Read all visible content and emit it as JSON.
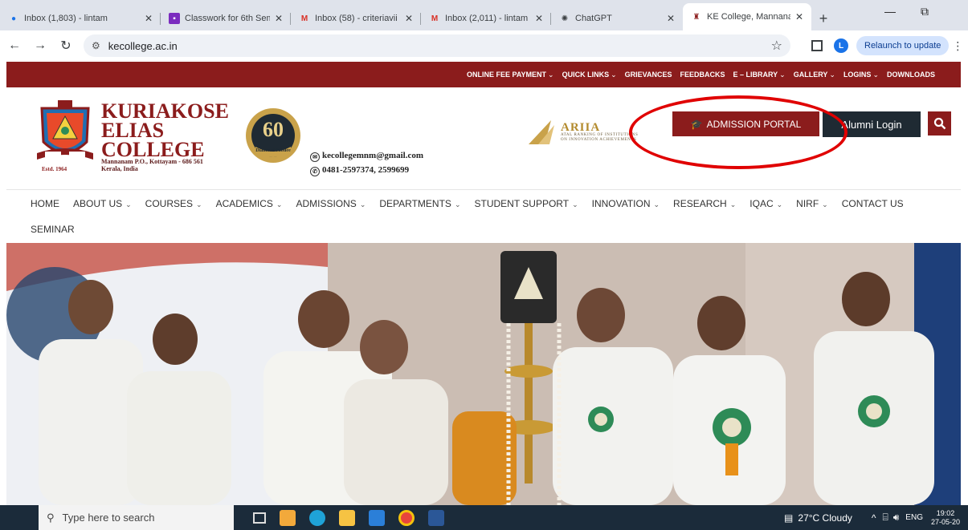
{
  "browser": {
    "tabs": [
      {
        "title": "Inbox (1,803) - lintam",
        "icon": "gmail-icon"
      },
      {
        "title": "Classwork for 6th Sem",
        "icon": "classroom-icon"
      },
      {
        "title": "Inbox (58) - criteriavii",
        "icon": "gmail-icon"
      },
      {
        "title": "Inbox (2,011) - lintam",
        "icon": "gmail-icon"
      },
      {
        "title": "ChatGPT",
        "icon": "chatgpt-icon"
      },
      {
        "title": "KE College, Mannanam",
        "icon": "college-favicon",
        "active": true
      }
    ],
    "url": "kecollege.ac.in",
    "profile_initial": "L",
    "relaunch_label": "Relaunch to update"
  },
  "site": {
    "top_links": [
      {
        "label": "ONLINE FEE PAYMENT",
        "dropdown": true
      },
      {
        "label": "QUICK LINKS",
        "dropdown": true
      },
      {
        "label": "GRIEVANCES",
        "dropdown": false
      },
      {
        "label": "FEEDBACKS",
        "dropdown": false
      },
      {
        "label": "E – LIBRARY",
        "dropdown": true
      },
      {
        "label": "GALLERY",
        "dropdown": true
      },
      {
        "label": "LOGINS",
        "dropdown": true
      },
      {
        "label": "DOWNLOADS",
        "dropdown": false
      }
    ],
    "college_name_lines": [
      "KURIAKOSE",
      "ELIAS",
      "COLLEGE"
    ],
    "address_lines": [
      "Mannanam P.O., Kottayam - 686 561",
      "Kerala, India"
    ],
    "estd": "Estd. 1964",
    "jubilee": {
      "number": "60",
      "text": "Diamond Jubilee"
    },
    "email": "kecollegemnm@gmail.com",
    "phone": "0481-2597374, 2599699",
    "ariia": {
      "name": "ARIIA",
      "sub_lines": [
        "ATAL RANKING OF INSTITUTIONS",
        "ON INNOVATION ACHIEVEMENTS"
      ]
    },
    "admission_portal_label": "ADMISSION PORTAL",
    "alumni_login_label": "Alumni Login",
    "main_nav": [
      {
        "label": "HOME",
        "dropdown": false
      },
      {
        "label": "ABOUT US",
        "dropdown": true
      },
      {
        "label": "COURSES",
        "dropdown": true
      },
      {
        "label": "ACADEMICS",
        "dropdown": true
      },
      {
        "label": "ADMISSIONS",
        "dropdown": true
      },
      {
        "label": "DEPARTMENTS",
        "dropdown": true
      },
      {
        "label": "STUDENT SUPPORT",
        "dropdown": true
      },
      {
        "label": "INNOVATION",
        "dropdown": true
      },
      {
        "label": "RESEARCH",
        "dropdown": true
      },
      {
        "label": "IQAC",
        "dropdown": true
      },
      {
        "label": "NIRF",
        "dropdown": true
      },
      {
        "label": "CONTACT US",
        "dropdown": false
      }
    ],
    "main_nav_row2": [
      {
        "label": "SEMINAR"
      }
    ],
    "colors": {
      "brand_red": "#8b1c1c",
      "dark_button": "#1f2a33",
      "annotation_red": "#e00000"
    }
  },
  "taskbar": {
    "search_placeholder": "Type here to search",
    "weather": "27°C  Cloudy",
    "language": "ENG",
    "time": "19:02",
    "date": "27-05-20"
  }
}
